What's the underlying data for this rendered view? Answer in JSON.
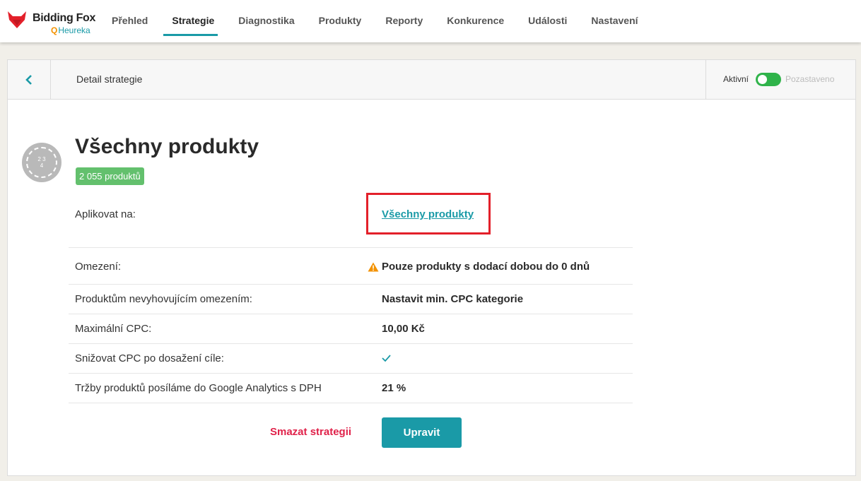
{
  "brand": {
    "name": "Bidding Fox",
    "sub": "Heureka",
    "accent": "#1a9aa7",
    "fox_color": "#e3202a"
  },
  "nav": {
    "items": [
      "Přehled",
      "Strategie",
      "Diagnostika",
      "Produkty",
      "Reporty",
      "Konkurence",
      "Události",
      "Nastavení"
    ],
    "active": "Strategie"
  },
  "header": {
    "title": "Detail strategie",
    "status_on": "Aktivní",
    "status_off": "Pozastaveno",
    "active": true
  },
  "icon_text": [
    "2",
    "3",
    "4"
  ],
  "strategy": {
    "title": "Všechny produkty",
    "badge": "2 055 produktů"
  },
  "rows": [
    {
      "label": "Aplikovat na:",
      "value": "Všechny produkty"
    },
    {
      "label": "Omezení:",
      "value": "Pouze produkty s dodací dobou do 0 dnů"
    },
    {
      "label": "Produktům nevyhovujícím omezením:",
      "value": "Nastavit min. CPC kategorie"
    },
    {
      "label": "Maximální CPC:",
      "value": "10,00 Kč"
    },
    {
      "label": "Snižovat CPC po dosažení cíle:",
      "value": "check-icon"
    },
    {
      "label": "Tržby produktů posíláme do Google Analytics s DPH",
      "value": "21 %"
    }
  ],
  "actions": {
    "delete": "Smazat strategii",
    "edit": "Upravit"
  }
}
